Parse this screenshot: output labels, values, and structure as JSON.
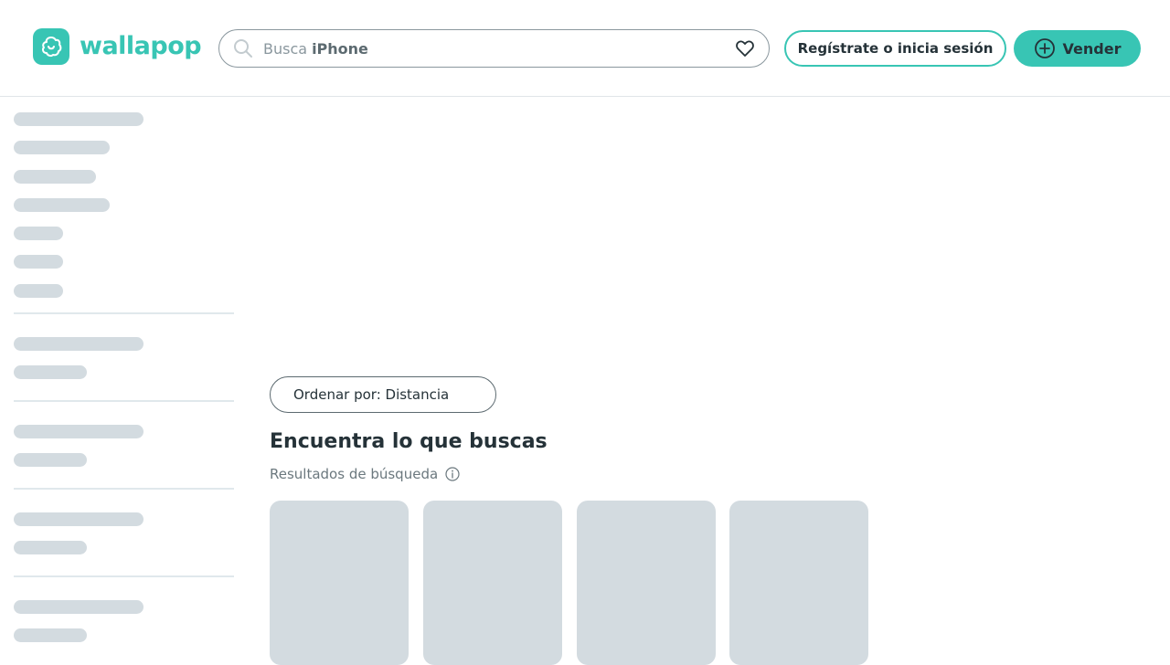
{
  "header": {
    "logo_text": "wallapop",
    "search": {
      "hint": "Busca",
      "suggestion": "iPhone"
    },
    "login_label": "Regístrate o inicia sesión",
    "sell_label": "Vender"
  },
  "main": {
    "sort_label": "Ordenar por: Distancia",
    "title": "Encuentra lo que buscas",
    "subtitle": "Resultados de búsqueda"
  },
  "colors": {
    "brand": "#38c5b4",
    "skeleton": "#d3dbe0",
    "text": "#253238"
  },
  "icons": [
    "wallapop-logo-icon",
    "search-icon",
    "heart-icon",
    "plus-circle-icon",
    "info-icon"
  ]
}
